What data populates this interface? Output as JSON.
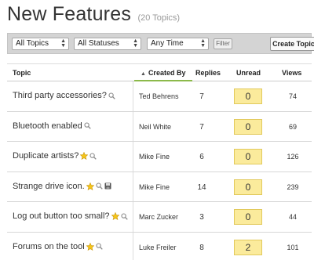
{
  "page": {
    "title": "New Features",
    "topic_count": "(20 Topics)"
  },
  "filters": {
    "topics": "All Topics",
    "statuses": "All Statuses",
    "time": "Any Time",
    "filter_button": "Filter",
    "create_button": "Create Topic"
  },
  "table": {
    "headers": {
      "topic": "Topic",
      "created_by": "Created By",
      "replies": "Replies",
      "unread": "Unread",
      "views": "Views"
    },
    "rows": [
      {
        "topic": "Third party accessories?",
        "created_by": "Ted Behrens",
        "replies": "7",
        "unread": "0",
        "views": "74",
        "icons": [
          "search-icon"
        ]
      },
      {
        "topic": "Bluetooth enabled",
        "created_by": "Neil White",
        "replies": "7",
        "unread": "0",
        "views": "69",
        "icons": [
          "search-icon"
        ]
      },
      {
        "topic": "Duplicate artists?",
        "created_by": "Mike Fine",
        "replies": "6",
        "unread": "0",
        "views": "126",
        "icons": [
          "star-icon",
          "search-icon"
        ]
      },
      {
        "topic": "Strange drive icon.",
        "created_by": "Mike Fine",
        "replies": "14",
        "unread": "0",
        "views": "239",
        "icons": [
          "star-icon",
          "search-icon",
          "disk-icon"
        ]
      },
      {
        "topic": "Log out button too small?",
        "created_by": "Marc Zucker",
        "replies": "3",
        "unread": "0",
        "views": "44",
        "icons": [
          "star-icon",
          "search-icon"
        ]
      },
      {
        "topic": "Forums on the tool",
        "created_by": "Luke Freiler",
        "replies": "8",
        "unread": "2",
        "views": "101",
        "icons": [
          "star-icon",
          "search-icon"
        ]
      }
    ]
  },
  "colors": {
    "unread_bg": "#fbeb9c",
    "unread_border": "#e2c95c",
    "sort_underline": "#8cb94a",
    "filterbar_bg": "#d4d4d4"
  }
}
